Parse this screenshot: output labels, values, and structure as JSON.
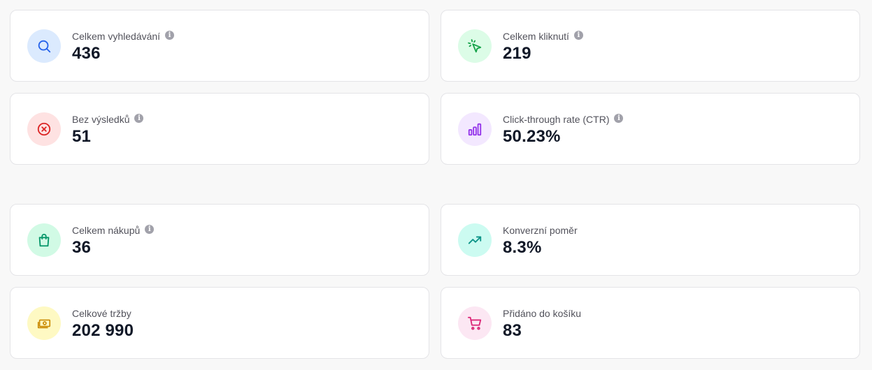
{
  "stats": [
    {
      "label": "Celkem vyhledávání",
      "value": "436",
      "icon": "search-icon",
      "info": true
    },
    {
      "label": "Celkem kliknutí",
      "value": "219",
      "icon": "click-cursor-icon",
      "info": true
    },
    {
      "label": "Bez výsledků",
      "value": "51",
      "icon": "x-circle-icon",
      "info": true
    },
    {
      "label": "Click-through rate (CTR)",
      "value": "50.23%",
      "icon": "bar-chart-icon",
      "info": true
    },
    {
      "label": "Celkem nákupů",
      "value": "36",
      "icon": "shopping-bag-icon",
      "info": true
    },
    {
      "label": "Konverzní poměr",
      "value": "8.3%",
      "icon": "trending-up-icon",
      "info": false
    },
    {
      "label": "Celkové tržby",
      "value": "202 990",
      "icon": "banknote-icon",
      "info": false
    },
    {
      "label": "Přidáno do košíku",
      "value": "83",
      "icon": "shopping-cart-icon",
      "info": false
    }
  ],
  "info_glyph": "i",
  "colors": {
    "blue_bg": "#dbeafe",
    "blue_fg": "#2563eb",
    "green_bg": "#dcfce7",
    "green_fg": "#16a34a",
    "red_bg": "#fee2e2",
    "red_fg": "#dc2626",
    "purple_bg": "#f3e8ff",
    "purple_fg": "#9333ea",
    "emerald_bg": "#d1fae5",
    "emerald_fg": "#059669",
    "teal_bg": "#ccfbf1",
    "teal_fg": "#0d9488",
    "yellow_bg": "#fef9c3",
    "yellow_fg": "#ca8a04",
    "pink_bg": "#fce7f3",
    "pink_fg": "#db2777"
  }
}
